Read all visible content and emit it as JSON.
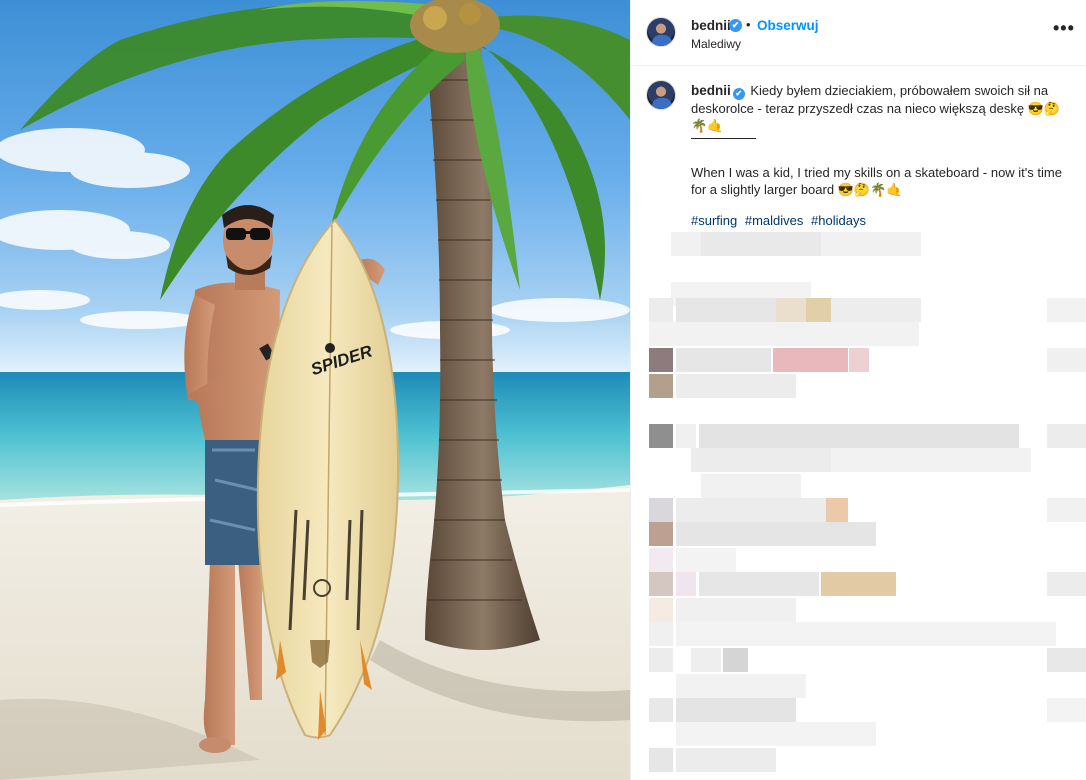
{
  "post": {
    "username": "bednii",
    "verified_mark": "✔",
    "separator": "•",
    "follow_label": "Obserwuj",
    "location": "Malediwy",
    "more_icon": "•••"
  },
  "caption": {
    "username": "bednii",
    "text_pl": "Kiedy byłem dzieciakiem, próbowałem swoich sił na deskorolce - teraz przyszedł czas na nieco większą deskę 😎🤔🌴🤙",
    "text_en": "When I was a kid, I tried my skills on a skateboard - now it's time for a slightly larger board 😎🤔🌴🤙",
    "hashtags": [
      "#surfing",
      "#maldives",
      "#holidays"
    ]
  },
  "photo": {
    "board_brand": "SPIDER"
  },
  "colors": {
    "link_blue": "#0095f6",
    "hashtag_blue": "#00376b",
    "verified_blue": "#3897f0",
    "text": "#262626"
  }
}
